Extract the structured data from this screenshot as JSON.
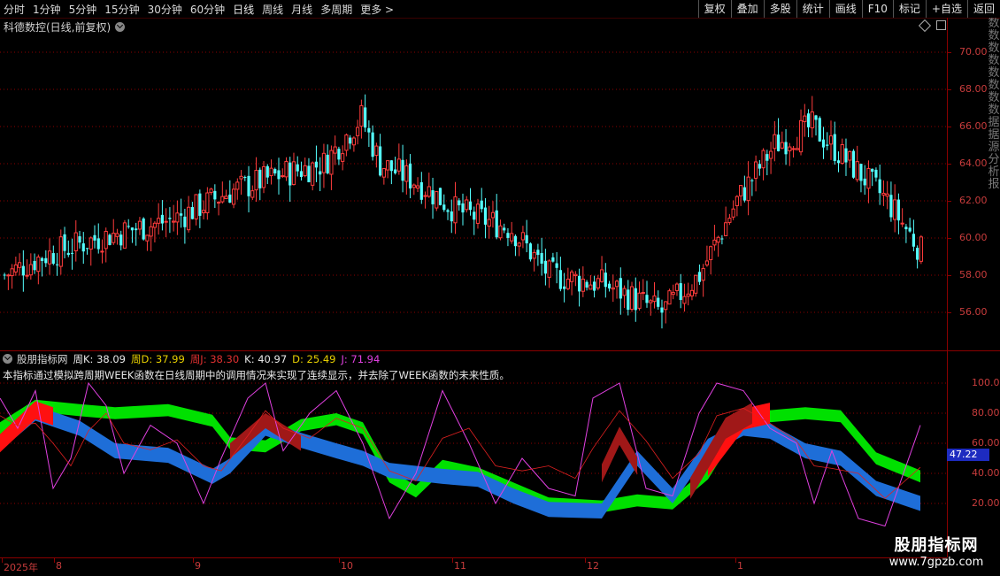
{
  "toolbar": {
    "periods": [
      "分时",
      "1分钟",
      "5分钟",
      "15分钟",
      "30分钟",
      "60分钟",
      "日线",
      "周线",
      "月线",
      "多周期",
      "更多 >"
    ],
    "actions": [
      "复权",
      "叠加",
      "多股",
      "统计",
      "画线",
      "F10",
      "标记",
      "+自选",
      "返回"
    ]
  },
  "stock_title": "科德数控(日线,前复权)",
  "price_axis_labels": [
    "70.00",
    "68.00",
    "66.00",
    "64.00",
    "62.00",
    "60.00",
    "58.00",
    "56.00"
  ],
  "indicator": {
    "name": "股朋指标网",
    "values": [
      {
        "label": "周K: 38.09",
        "color": "#e8e8e8"
      },
      {
        "label": "周D: 37.99",
        "color": "#e8d000"
      },
      {
        "label": "周J: 38.30",
        "color": "#e03030"
      },
      {
        "label": "K: 40.97",
        "color": "#e8e8e8"
      },
      {
        "label": "D: 25.49",
        "color": "#e8d000"
      },
      {
        "label": "J: 71.94",
        "color": "#e040e0"
      }
    ],
    "description": "本指标通过模拟跨周期WEEK函数在日线周期中的调用情况来实现了连续显示，并去除了WEEK函数的未来性质。",
    "axis_labels": [
      "100.0",
      "80.00",
      "60.00",
      "40.00",
      "20.00"
    ],
    "current_value": "47.22"
  },
  "time_axis": {
    "labels": [
      "2025年",
      "8",
      "9",
      "10",
      "11",
      "12",
      "1"
    ]
  },
  "side_strip_chars": [
    "数",
    "数",
    "数",
    "数",
    "数",
    "数",
    "数",
    "数",
    "据",
    "据",
    "源",
    "分",
    "析",
    "报"
  ],
  "watermark": {
    "line1": "股朋指标网",
    "line2": "www.7gpzb.com"
  },
  "colors": {
    "up": "#ff3c3c",
    "down": "#54ffff",
    "grid": "#8b0000",
    "axis_text": "#c83c3c"
  }
}
